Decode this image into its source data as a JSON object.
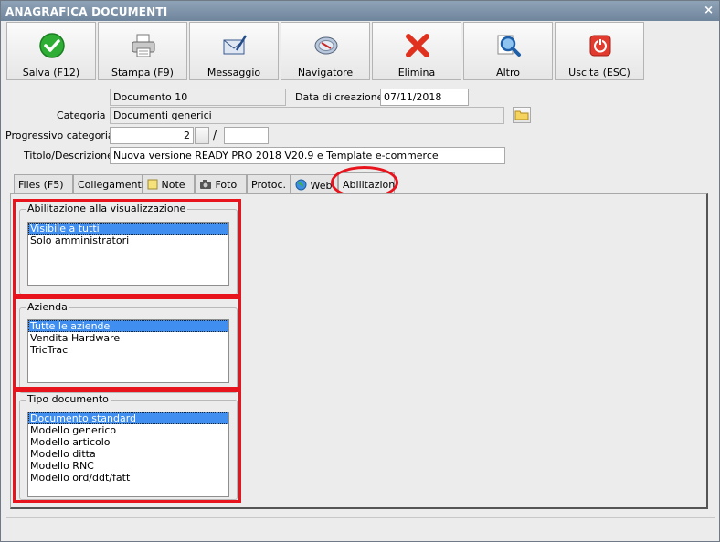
{
  "window": {
    "title": "ANAGRAFICA DOCUMENTI",
    "close_glyph": "×"
  },
  "toolbar": [
    {
      "label": "Salva (F12)",
      "icon": "check-icon"
    },
    {
      "label": "Stampa (F9)",
      "icon": "printer-icon"
    },
    {
      "label": "Messaggio",
      "icon": "envelope-icon"
    },
    {
      "label": "Navigatore",
      "icon": "compass-icon"
    },
    {
      "label": "Elimina",
      "icon": "delete-x-icon"
    },
    {
      "label": "Altro",
      "icon": "magnifier-icon"
    },
    {
      "label": "Uscita (ESC)",
      "icon": "power-icon"
    }
  ],
  "form": {
    "documento": "Documento 10",
    "data_label": "Data di creazione :",
    "data_value": "07/11/2018",
    "categoria_label": "Categoria :",
    "categoria_value": "Documenti generici",
    "progressivo_label": "Progressivo categoria :",
    "progressivo_value": "2",
    "progressivo_sep": "/",
    "progressivo_value2": "",
    "titolo_label": "Titolo/Descrizione :",
    "titolo_value": "Nuova versione READY PRO 2018 V20.9 e Template e-commerce"
  },
  "tabs": [
    {
      "label": "Files (F5)",
      "icon": ""
    },
    {
      "label": "Collegamenti",
      "icon": ""
    },
    {
      "label": "Note",
      "icon": "note-icon"
    },
    {
      "label": "Foto",
      "icon": "camera-icon"
    },
    {
      "label": "Protoc.",
      "icon": ""
    },
    {
      "label": "Web",
      "icon": "globe-icon"
    },
    {
      "label": "Abilitazioni",
      "icon": "",
      "active": true
    }
  ],
  "groups": {
    "visualizzazione": {
      "title": "Abilitazione alla visualizzazione",
      "items": [
        "Visibile a tutti",
        "Solo amministratori"
      ],
      "selected": 0
    },
    "azienda": {
      "title": "Azienda",
      "items": [
        "Tutte le aziende",
        "Vendita Hardware",
        "TricTrac"
      ],
      "selected": 0
    },
    "tipo": {
      "title": "Tipo documento",
      "items": [
        "Documento standard",
        "Modello generico",
        "Modello articolo",
        "Modello ditta",
        "Modello RNC",
        "Modello ord/ddt/fatt"
      ],
      "selected": 0
    }
  },
  "colors": {
    "annotation_red": "#e8141d",
    "selection_blue": "#3f8ef0",
    "titlebar": "#7f94aa"
  }
}
